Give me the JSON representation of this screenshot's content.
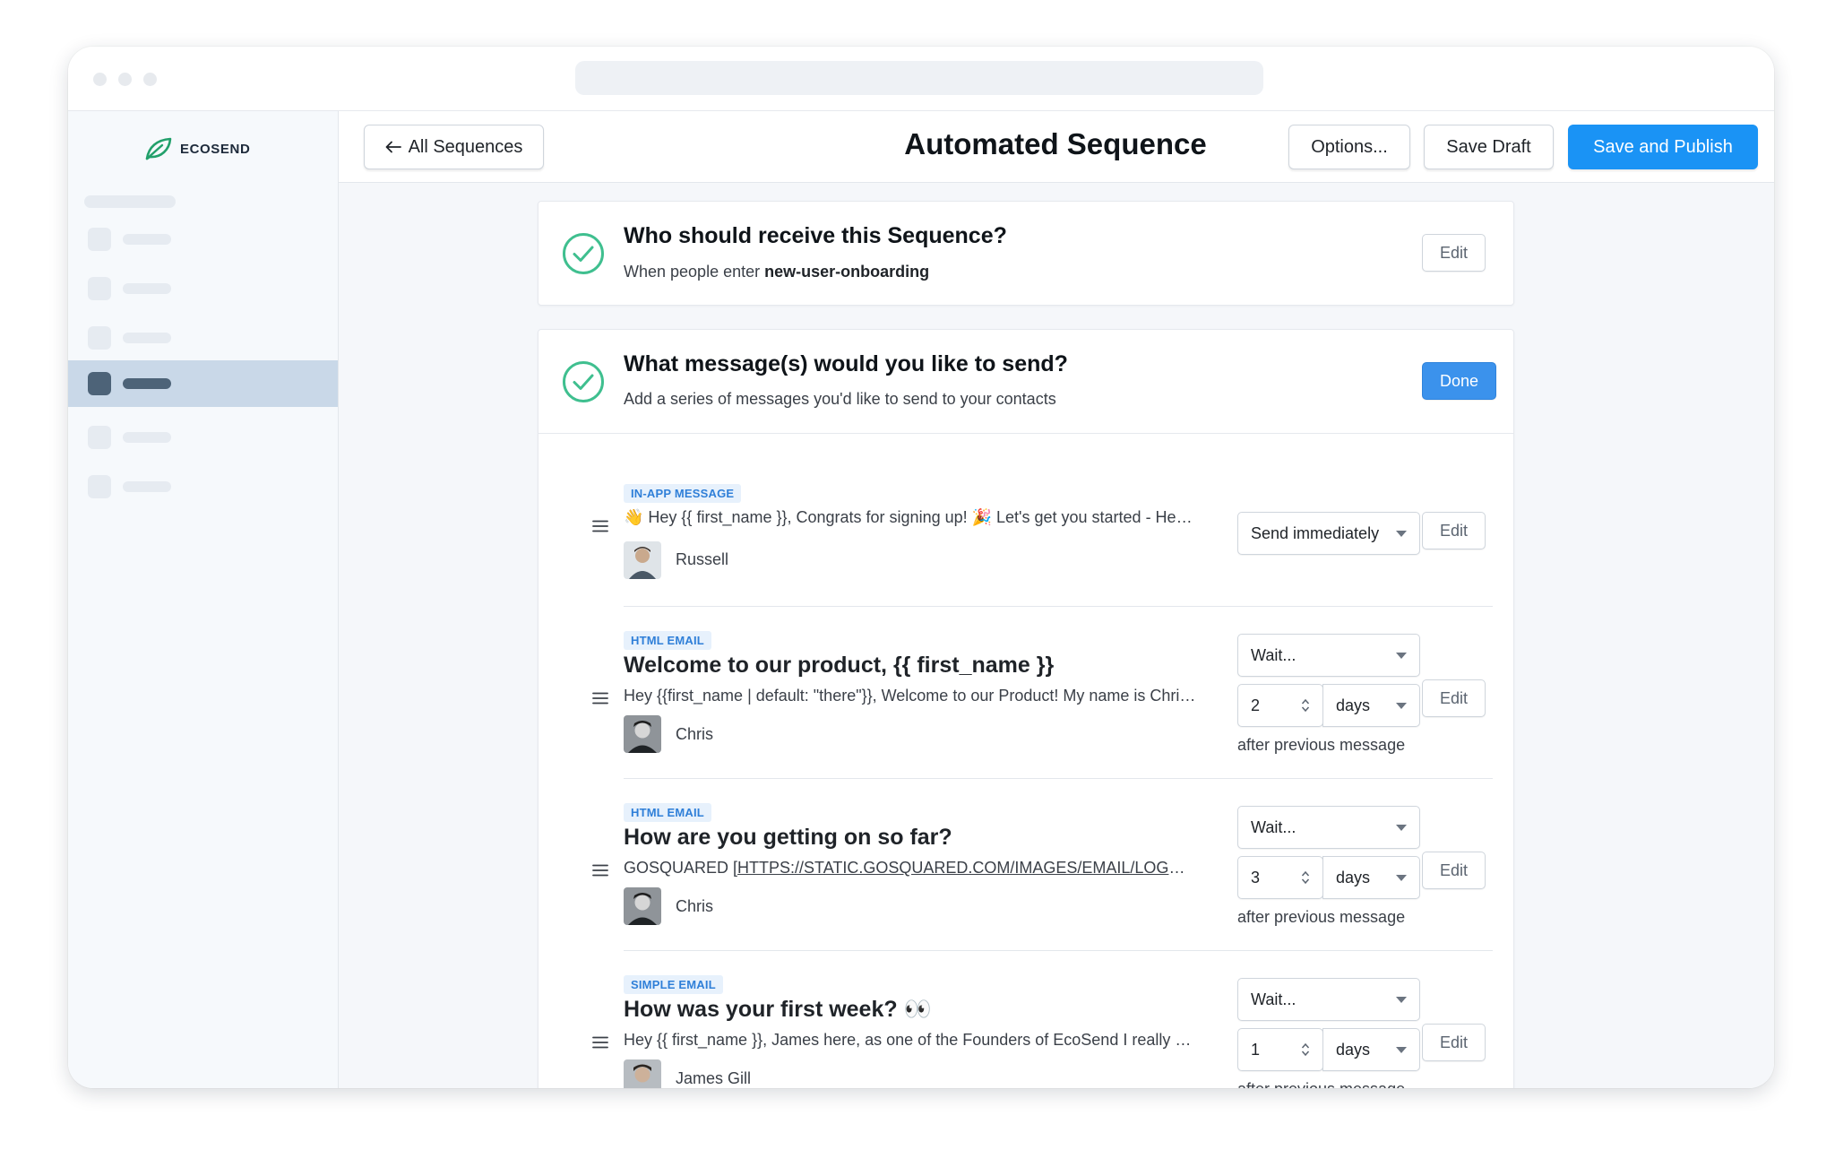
{
  "app": {
    "logo_text": "ECOSEND"
  },
  "header": {
    "back_label": "All Sequences",
    "title": "Automated Sequence",
    "options_label": "Options...",
    "save_draft_label": "Save Draft",
    "publish_label": "Save and Publish"
  },
  "audience": {
    "title": "Who should receive this Sequence?",
    "subtitle_prefix": "When people enter",
    "segment": "new-user-onboarding",
    "edit_label": "Edit"
  },
  "messages_section": {
    "title": "What message(s) would you like to send?",
    "subtitle": "Add a series of messages you'd like to send to your contacts",
    "done_label": "Done"
  },
  "messages": [
    {
      "type": "IN-APP MESSAGE",
      "preview": "👋 Hey {{ first_name }}, Congrats for signing up! 🎉 Let's get you started - Here's a quick tour",
      "sender": "Russell",
      "timing": "Send immediately",
      "edit_label": "Edit"
    },
    {
      "type": "HTML EMAIL",
      "subject": "Welcome to our product, {{ first_name }}",
      "preview": "Hey {{first_name | default: \"there\"}}, Welcome to our Product! My name is Chris and I'm",
      "sender": "Chris",
      "timing": "Wait...",
      "amount": "2",
      "unit": "days",
      "after": "after previous message",
      "edit_label": "Edit"
    },
    {
      "type": "HTML EMAIL",
      "subject": "How are you getting on so far?",
      "preview_prefix": "GOSQUARED [",
      "preview_link": "HTTPS://STATIC.GOSQUARED.COM/IMAGES/EMAIL/LOGO.PNG",
      "sender": "Chris",
      "timing": "Wait...",
      "amount": "3",
      "unit": "days",
      "after": "after previous message",
      "edit_label": "Edit"
    },
    {
      "type": "SIMPLE EMAIL",
      "subject": "How was your first week? 👀",
      "preview": "Hey {{ first_name }}, James here, as one of the Founders of EcoSend I really wanted to",
      "sender": "James Gill",
      "timing": "Wait...",
      "amount": "1",
      "unit": "days",
      "after": "after previous message",
      "edit_label": "Edit"
    }
  ],
  "colors": {
    "accent": "#1a93f5",
    "check": "#3fbf8f",
    "tag_bg": "#e7f1fc",
    "tag_text": "#2f7fd8",
    "sidebar_active": "#c9d8e8"
  }
}
